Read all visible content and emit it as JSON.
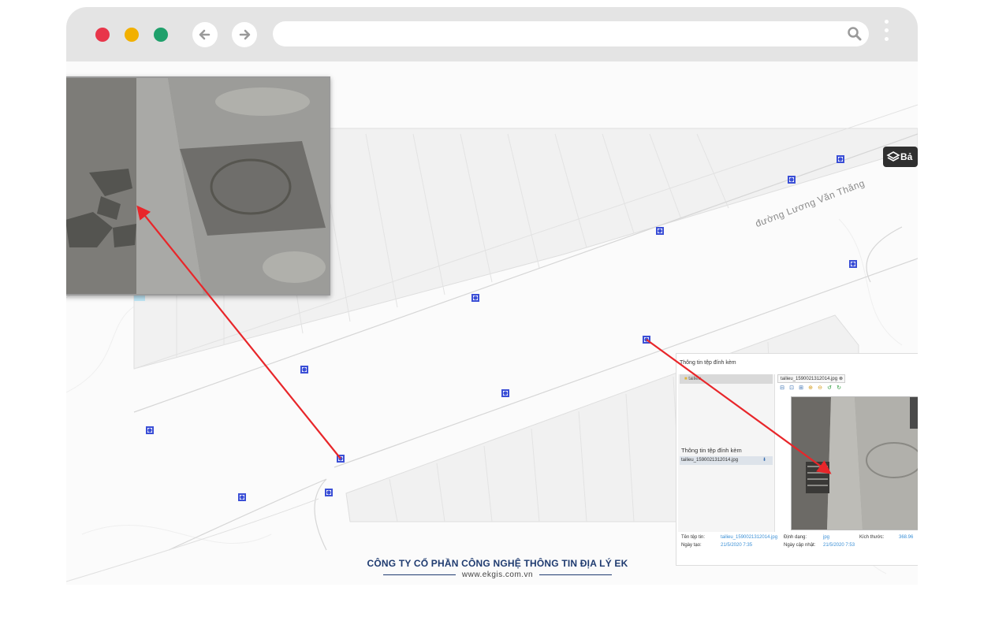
{
  "browser": {
    "window_controls": [
      "close-dot",
      "minimize-dot",
      "maximize-dot"
    ],
    "colors": {
      "close": "#e8364a",
      "minimize": "#f2b000",
      "maximize": "#1fa06b",
      "chrome": "#e4e4e4"
    },
    "back_icon": "arrow-left-icon",
    "forward_icon": "arrow-right-icon",
    "search_icon": "search-icon",
    "menu_icon": "kebab-menu-icon"
  },
  "map": {
    "street_label": "đường Lương Văn Thăng",
    "layers_button_label": "Bả",
    "layers_icon": "layers-icon",
    "marker_icon": "manhole-marker-icon",
    "marker_color": "#3b4fd6",
    "arrow_color": "#e8262a"
  },
  "panel": {
    "title": "Thông tin tệp đính kèm",
    "tree_item": "tailieu",
    "side_title": "Thông tin tệp đính kèm",
    "file_name": "tailieu_1590021312014.jpg",
    "tab_label": "tailieu_1590021312014.jpg",
    "labels": {
      "file_name": "Tên tệp tin:",
      "created": "Ngày tạo:",
      "format": "Định dạng:",
      "updated": "Ngày cập nhật:",
      "size": "Kích thước:"
    },
    "values": {
      "file_name": "tailieu_1590021312014.jpg",
      "created": "21/5/2020 7:35",
      "format": "jpg",
      "updated": "21/5/2020 7:53",
      "size": "368.96"
    }
  },
  "footer": {
    "company": "CÔNG TY CỔ PHẦN CÔNG NGHỆ THÔNG TIN ĐỊA LÝ EK",
    "website": "www.ekgis.com.vn",
    "color": "#1f3b70"
  }
}
